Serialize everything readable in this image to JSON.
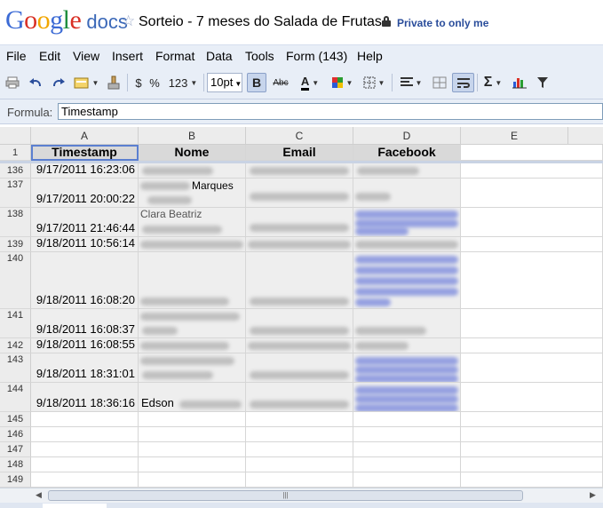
{
  "header": {
    "logo_google": "Google",
    "logo_docs": "docs",
    "star": "☆",
    "title": "Sorteio - 7 meses do Salada de Frutas",
    "privacy": "Private to only me"
  },
  "menu": [
    "File",
    "Edit",
    "View",
    "Insert",
    "Format",
    "Data",
    "Tools",
    "Form (143)",
    "Help"
  ],
  "toolbar": {
    "currency": "$",
    "percent": "%",
    "number_format": "123",
    "font_size": "10pt",
    "bold": "B",
    "strike": "Abc",
    "text_color": "A",
    "sum": "Σ",
    "icons": [
      "print-icon",
      "undo-icon",
      "redo-icon",
      "format-icon",
      "paint-format-icon",
      "currency-icon",
      "percent-icon",
      "number-format-icon",
      "font-size-select",
      "bold-icon",
      "strikethrough-icon",
      "text-color-icon",
      "fill-color-icon",
      "borders-icon",
      "align-icon",
      "merge-icon",
      "wrap-icon",
      "sum-icon",
      "chart-icon",
      "filter-icon"
    ]
  },
  "formula": {
    "label": "Formula:",
    "value": "Timestamp"
  },
  "columns": [
    "A",
    "B",
    "C",
    "D",
    "E"
  ],
  "table": {
    "headers": [
      "Timestamp",
      "Nome",
      "Email",
      "Facebook"
    ],
    "rows": [
      {
        "num": "1",
        "timestamp": "",
        "nome": "",
        "email": "",
        "facebook": ""
      },
      {
        "num": "136",
        "timestamp": "9/17/2011 16:23:06",
        "nome": "",
        "email": "",
        "facebook": ""
      },
      {
        "num": "137",
        "timestamp": "9/17/2011 20:00:22",
        "nome": "Marques",
        "email": "",
        "facebook": ""
      },
      {
        "num": "138",
        "timestamp": "9/17/2011 21:46:44",
        "nome": "Clara Beatriz",
        "email": "",
        "facebook": ""
      },
      {
        "num": "139",
        "timestamp": "9/18/2011 10:56:14",
        "nome": "",
        "email": "",
        "facebook": ""
      },
      {
        "num": "140",
        "timestamp": "9/18/2011 16:08:20",
        "nome": "",
        "email": "",
        "facebook": ""
      },
      {
        "num": "141",
        "timestamp": "9/18/2011 16:08:37",
        "nome": "",
        "email": "",
        "facebook": ""
      },
      {
        "num": "142",
        "timestamp": "9/18/2011 16:08:55",
        "nome": "",
        "email": "",
        "facebook": ""
      },
      {
        "num": "143",
        "timestamp": "9/18/2011 18:31:01",
        "nome": "",
        "email": "",
        "facebook": ""
      },
      {
        "num": "144",
        "timestamp": "9/18/2011 18:36:16",
        "nome": "Edson",
        "email": "",
        "facebook": ""
      }
    ],
    "empty_rows": [
      "145",
      "146",
      "147",
      "148",
      "149"
    ]
  },
  "scroll_thumb_label": "|||"
}
